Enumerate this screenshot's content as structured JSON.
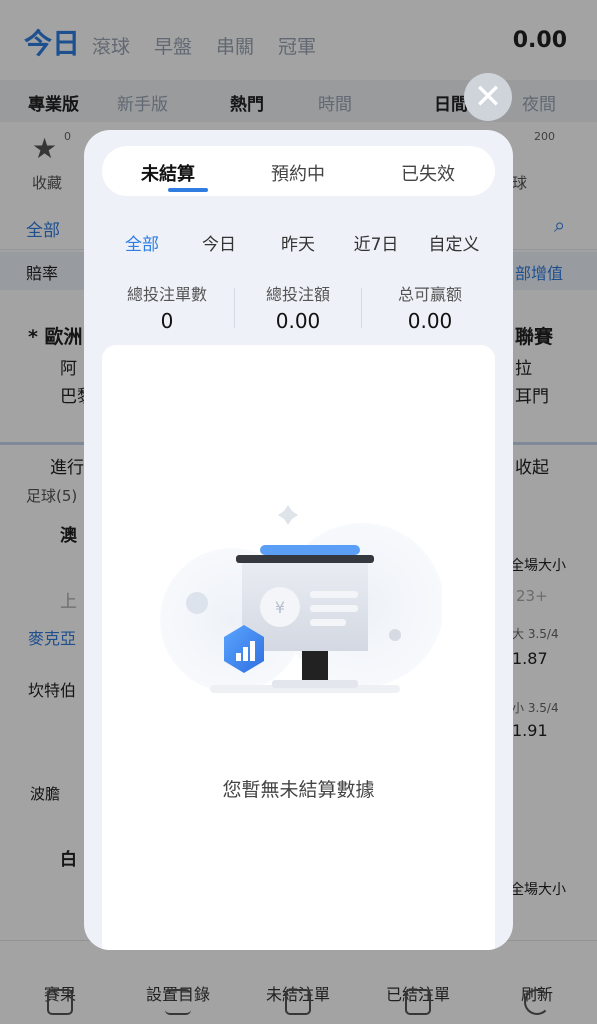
{
  "header": {
    "title": "今日",
    "nav": [
      "滾球",
      "早盤",
      "串關",
      "冠軍"
    ],
    "balance": "0.00"
  },
  "subheader": {
    "left": [
      "專業版",
      "新手版"
    ],
    "sort": [
      "熱門",
      "時間"
    ],
    "mode": [
      "日間",
      "夜間"
    ]
  },
  "bg_items": {
    "favorites": "收藏",
    "count": "0",
    "count_right": "200",
    "ball": "球",
    "filter_all": "全部",
    "notice": "賠率",
    "notice_right": "部增值",
    "match_title": "* 歐洲",
    "match_title_right": "聯賽",
    "team1": "阿",
    "team2": "巴黎",
    "team1_right": "拉",
    "team2_right": "耳門",
    "live": "進行",
    "collapse": "收起",
    "soccer": "足球(5)",
    "league1": "澳",
    "league2": "白",
    "market": "全場大小",
    "market2": "全場大小",
    "upcoming": "上",
    "mk": "麥克亞",
    "kt": "坎特伯",
    "odds_line1": "大 3.5/4",
    "odds1": "1.87",
    "odds_line2": "小 3.5/4",
    "odds2": "1.91",
    "more": "23+",
    "bodan": "波膽"
  },
  "bottom_nav": [
    {
      "label": "賽果"
    },
    {
      "label": "設置目錄"
    },
    {
      "label": "未結注單"
    },
    {
      "label": "已結注單"
    },
    {
      "label": "刷新"
    }
  ],
  "modal": {
    "close": "✕",
    "tabs": [
      "未結算",
      "預約中",
      "已失效"
    ],
    "date_filters": [
      "全部",
      "今日",
      "昨天",
      "近7日",
      "自定义"
    ],
    "stats": [
      {
        "label": "總投注單數",
        "value": "0"
      },
      {
        "label": "總投注額",
        "value": "0.00"
      },
      {
        "label": "总可赢额",
        "value": "0.00"
      }
    ],
    "empty_message": "您暫無未結算數據",
    "currency_symbol": "¥"
  },
  "colors": {
    "accent": "#2f7de1",
    "overlay": "rgba(0,0,0,0.36)"
  }
}
